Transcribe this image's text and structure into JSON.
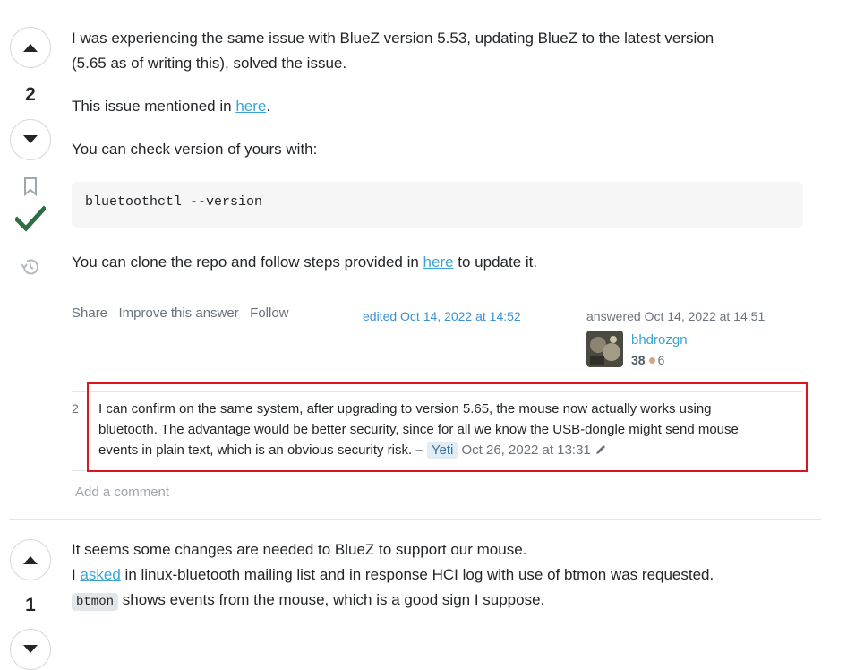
{
  "answer1": {
    "vote_count": "2",
    "para1": "I was experiencing the same issue with BlueZ version 5.53, updating BlueZ to the latest version",
    "para1b": "(5.65 as of writing this), solved the issue.",
    "para2_prefix": "This issue mentioned in ",
    "para2_link": "here",
    "para2_suffix": ".",
    "para3": "You can check version of yours with:",
    "code": "bluetoothctl --version",
    "para4_prefix": "You can clone the repo and follow steps provided in ",
    "para4_link": "here",
    "para4_suffix": " to update it.",
    "menu": {
      "share": "Share",
      "improve": "Improve this answer",
      "follow": "Follow"
    },
    "edited": "edited Oct 14, 2022 at 14:52",
    "answered": "answered Oct 14, 2022 at 14:51",
    "user": {
      "name": "bhdrozgn",
      "reputation": "38",
      "bronze_badges": "6"
    },
    "comment": {
      "score": "2",
      "line1": "I can confirm on the same system, after upgrading to version 5.65, the mouse now actually works using",
      "line2": "bluetooth. The advantage would be better security, since for all we know the USB-dongle might send mouse",
      "line3": "events in plain text, which is an obvious security risk. –",
      "user": "Yeti",
      "date": "Oct 26, 2022 at 13:31"
    },
    "add_comment": "Add a comment"
  },
  "answer2": {
    "vote_count": "1",
    "line1": "It seems some changes are needed to BlueZ to support our mouse.",
    "line2_prefix": "I ",
    "line2_link": "asked",
    "line2_suffix": " in linux-bluetooth mailing list and in response HCI log with use of btmon was requested.",
    "line3_code": "btmon",
    "line3_suffix": " shows events from the mouse, which is a good sign I suppose."
  },
  "colors": {
    "accepted": "#2f6f44",
    "highlight_border": "#e0121b",
    "link": "#3ba5d2"
  },
  "icons": [
    "upvote-icon",
    "downvote-icon",
    "bookmark-icon",
    "accepted-check-icon",
    "history-icon",
    "pencil-icon"
  ]
}
